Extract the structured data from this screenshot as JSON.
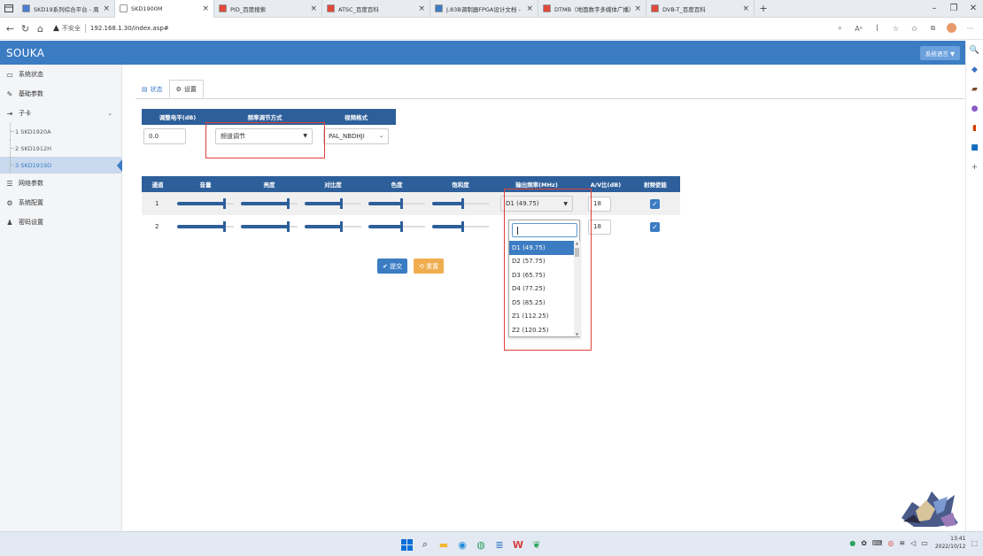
{
  "browser": {
    "tabs": [
      {
        "label": "SKD19系列综合平台 - 周用数字",
        "active": false
      },
      {
        "label": "SKD1900M",
        "active": true
      },
      {
        "label": "PID_百度搜索",
        "active": false
      },
      {
        "label": "ATSC_百度百科",
        "active": false
      },
      {
        "label": "J.83B调制器FPGA设计文档 - 知",
        "active": false
      },
      {
        "label": "DTMB（地面数字多媒体广播）",
        "active": false
      },
      {
        "label": "DVB-T_百度百科",
        "active": false
      }
    ],
    "insecure_label": "不安全",
    "url": "192.168.1.30/index.asp#"
  },
  "app": {
    "brand": "SOUKA",
    "language_button": "系统语言 ▼"
  },
  "sidebar": {
    "items": [
      {
        "label": "系统状态",
        "icon": "monitor-icon"
      },
      {
        "label": "基础参数",
        "icon": "pencil-icon"
      },
      {
        "label": "子卡",
        "icon": "signin-icon",
        "expanded": true
      }
    ],
    "subitems": [
      {
        "label": "1  SKD1920A",
        "active": false
      },
      {
        "label": "2  SKD1912H",
        "active": false
      },
      {
        "label": "3  SKD1919D",
        "active": true
      }
    ],
    "items_after": [
      {
        "label": "网络参数",
        "icon": "list-icon"
      },
      {
        "label": "系统配置",
        "icon": "gear-icon"
      },
      {
        "label": "密码设置",
        "icon": "user-icon"
      }
    ]
  },
  "content": {
    "tabs": [
      {
        "label": "状态",
        "active": false
      },
      {
        "label": "设置",
        "active": true
      }
    ],
    "table1": {
      "headers": [
        "调整电平(dB)",
        "频率调节方式",
        "视频格式"
      ],
      "level_value": "0.0",
      "freq_mode": "频道调节",
      "video_format": "PAL_NBDHJI"
    },
    "table2": {
      "headers": [
        "通道",
        "音量",
        "亮度",
        "对比度",
        "色度",
        "饱和度",
        "输出频率(MHz)",
        "A/V比(dB)",
        "射频使能"
      ],
      "rows": [
        {
          "channel": "1",
          "sliders": [
            0.85,
            0.85,
            0.65,
            0.6,
            0.55
          ],
          "freq": "D1 (49.75)",
          "av": "18",
          "rf": true
        },
        {
          "channel": "2",
          "sliders": [
            0.85,
            0.85,
            0.65,
            0.6,
            0.55
          ],
          "freq": "D1 (49.75)",
          "av": "18",
          "rf": true
        }
      ]
    },
    "submit_label": "✔ 提交",
    "reset_label": "⟲ 重置"
  },
  "dropdown": {
    "options": [
      "D1 (49.75)",
      "D2 (57.75)",
      "D3 (65.75)",
      "D4 (77.25)",
      "D5 (85.25)",
      "Z1 (112.25)",
      "Z2 (120.25)"
    ],
    "selected": 0
  },
  "taskbar": {
    "time": "13:41",
    "date": "2022/10/12"
  },
  "colors": {
    "accent": "#3b7cc3",
    "header_dark": "#2d5f9a",
    "highlight_red": "#e0403a",
    "submit": "#3b7cc3",
    "reset": "#f0ad4e"
  }
}
